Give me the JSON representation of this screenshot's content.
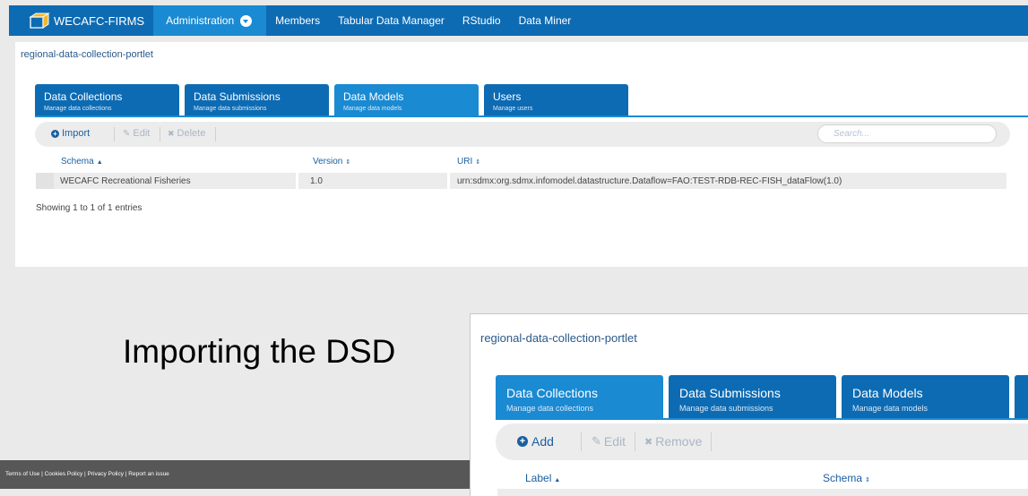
{
  "nav": {
    "brand": "WECAFC-FIRMS",
    "items": [
      {
        "label": "Administration"
      },
      {
        "label": "Members"
      },
      {
        "label": "Tabular Data Manager"
      },
      {
        "label": "RStudio"
      },
      {
        "label": "Data Miner"
      }
    ]
  },
  "portlet": {
    "title": "regional-data-collection-portlet",
    "tabs": [
      {
        "title": "Data Collections",
        "subtitle": "Manage data collections"
      },
      {
        "title": "Data Submissions",
        "subtitle": "Manage data submissions"
      },
      {
        "title": "Data Models",
        "subtitle": "Manage data models"
      },
      {
        "title": "Users",
        "subtitle": "Manage users"
      }
    ],
    "active_tab": "Data Models",
    "toolbar": {
      "import": "Import",
      "edit": "Edit",
      "delete": "Delete",
      "search_placeholder": "Search..."
    },
    "columns": [
      "Schema",
      "Version",
      "URI"
    ],
    "rows": [
      {
        "schema": "WECAFC Recreational Fisheries",
        "version": "1.0",
        "uri": "urn:sdmx:org.sdmx.infomodel.datastructure.Dataflow=FAO:TEST-RDB-REC-FISH_dataFlow(1.0)"
      }
    ],
    "showing": "Showing 1 to 1 of 1 entries"
  },
  "caption": "Importing the DSD",
  "footer": {
    "text": "Terms of Use | Cookies Policy | Privacy Policy | Report an issue"
  },
  "inset": {
    "title": "regional-data-collection-portlet",
    "tabs": [
      {
        "title": "Data Collections",
        "subtitle": "Manage data collections"
      },
      {
        "title": "Data Submissions",
        "subtitle": "Manage data submissions"
      },
      {
        "title": "Data Models",
        "subtitle": "Manage data models"
      }
    ],
    "active_tab": "Data Collections",
    "toolbar": {
      "add": "Add",
      "edit": "Edit",
      "remove": "Remove"
    },
    "columns": [
      "Label",
      "Schema"
    ]
  },
  "colors": {
    "nav_bg": "#0d6bb3",
    "active_tab": "#1a8ad2",
    "link": "#1a5fa0"
  }
}
